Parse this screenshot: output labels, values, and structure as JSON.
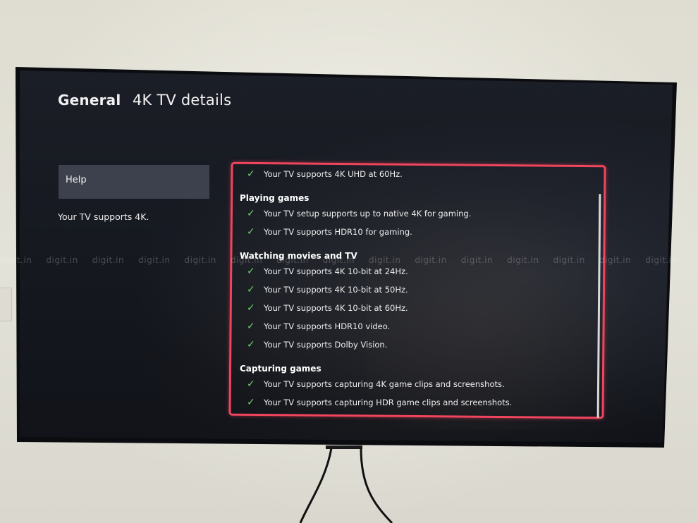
{
  "header": {
    "section": "General",
    "page_title": "4K TV details"
  },
  "sidebar": {
    "help_label": "Help",
    "summary": "Your TV supports 4K."
  },
  "details": {
    "top_item": "Your TV supports 4K UHD at 60Hz.",
    "sections": [
      {
        "heading": "Playing games",
        "items": [
          "Your TV setup supports up to native 4K for gaming.",
          "Your TV supports HDR10 for gaming."
        ]
      },
      {
        "heading": "Watching movies and TV",
        "items": [
          "Your TV supports 4K 10-bit at 24Hz.",
          "Your TV supports 4K 10-bit at 50Hz.",
          "Your TV supports 4K 10-bit at 60Hz.",
          "Your TV supports HDR10 video.",
          "Your TV supports Dolby Vision."
        ]
      },
      {
        "heading": "Capturing games",
        "items": [
          "Your TV supports capturing 4K game clips and screenshots.",
          "Your TV supports capturing HDR game clips and screenshots."
        ]
      }
    ],
    "check_icon": "check-icon"
  },
  "watermark": "digit.in",
  "colors": {
    "highlight_border": "#f0455d",
    "check": "#6fd06a",
    "focused_tab": "#3c414d"
  }
}
